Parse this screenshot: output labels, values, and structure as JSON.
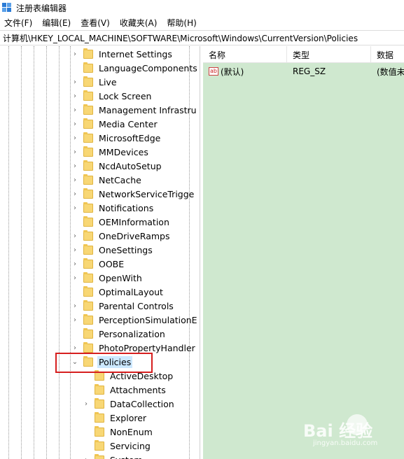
{
  "window": {
    "title": "注册表编辑器"
  },
  "menu": [
    "文件(F)",
    "编辑(E)",
    "查看(V)",
    "收藏夹(A)",
    "帮助(H)"
  ],
  "address": "计算机\\HKEY_LOCAL_MACHINE\\SOFTWARE\\Microsoft\\Windows\\CurrentVersion\\Policies",
  "tree": {
    "items": [
      {
        "label": "Internet Settings",
        "expander": "›"
      },
      {
        "label": "LanguageComponents",
        "expander": ""
      },
      {
        "label": "Live",
        "expander": "›"
      },
      {
        "label": "Lock Screen",
        "expander": "›"
      },
      {
        "label": "Management Infrastru",
        "expander": "›"
      },
      {
        "label": "Media Center",
        "expander": "›"
      },
      {
        "label": "MicrosoftEdge",
        "expander": "›"
      },
      {
        "label": "MMDevices",
        "expander": "›"
      },
      {
        "label": "NcdAutoSetup",
        "expander": "›"
      },
      {
        "label": "NetCache",
        "expander": "›"
      },
      {
        "label": "NetworkServiceTrigge",
        "expander": "›"
      },
      {
        "label": "Notifications",
        "expander": "›"
      },
      {
        "label": "OEMInformation",
        "expander": ""
      },
      {
        "label": "OneDriveRamps",
        "expander": "›"
      },
      {
        "label": "OneSettings",
        "expander": "›"
      },
      {
        "label": "OOBE",
        "expander": "›"
      },
      {
        "label": "OpenWith",
        "expander": "›"
      },
      {
        "label": "OptimalLayout",
        "expander": ""
      },
      {
        "label": "Parental Controls",
        "expander": "›"
      },
      {
        "label": "PerceptionSimulationE",
        "expander": "›"
      },
      {
        "label": "Personalization",
        "expander": ""
      },
      {
        "label": "PhotoPropertyHandler",
        "expander": "›"
      },
      {
        "label": "Policies",
        "expander": "⌄"
      }
    ],
    "children": [
      {
        "label": "ActiveDesktop",
        "expander": ""
      },
      {
        "label": "Attachments",
        "expander": ""
      },
      {
        "label": "DataCollection",
        "expander": "›"
      },
      {
        "label": "Explorer",
        "expander": ""
      },
      {
        "label": "NonEnum",
        "expander": ""
      },
      {
        "label": "Servicing",
        "expander": ""
      },
      {
        "label": "System",
        "expander": "›"
      }
    ]
  },
  "list": {
    "headers": [
      "名称",
      "类型",
      "数据"
    ],
    "rows": [
      {
        "name": "(默认)",
        "type": "REG_SZ",
        "data": "(数值未"
      }
    ]
  },
  "watermark": {
    "text": "Bai 经验",
    "sub": "jingyan.baidu.com"
  },
  "colors": {
    "selection": "#cce8ff",
    "rightpane_bg": "#cfe8cf",
    "highlight": "#d61f1f",
    "folder": "#f8d775"
  }
}
